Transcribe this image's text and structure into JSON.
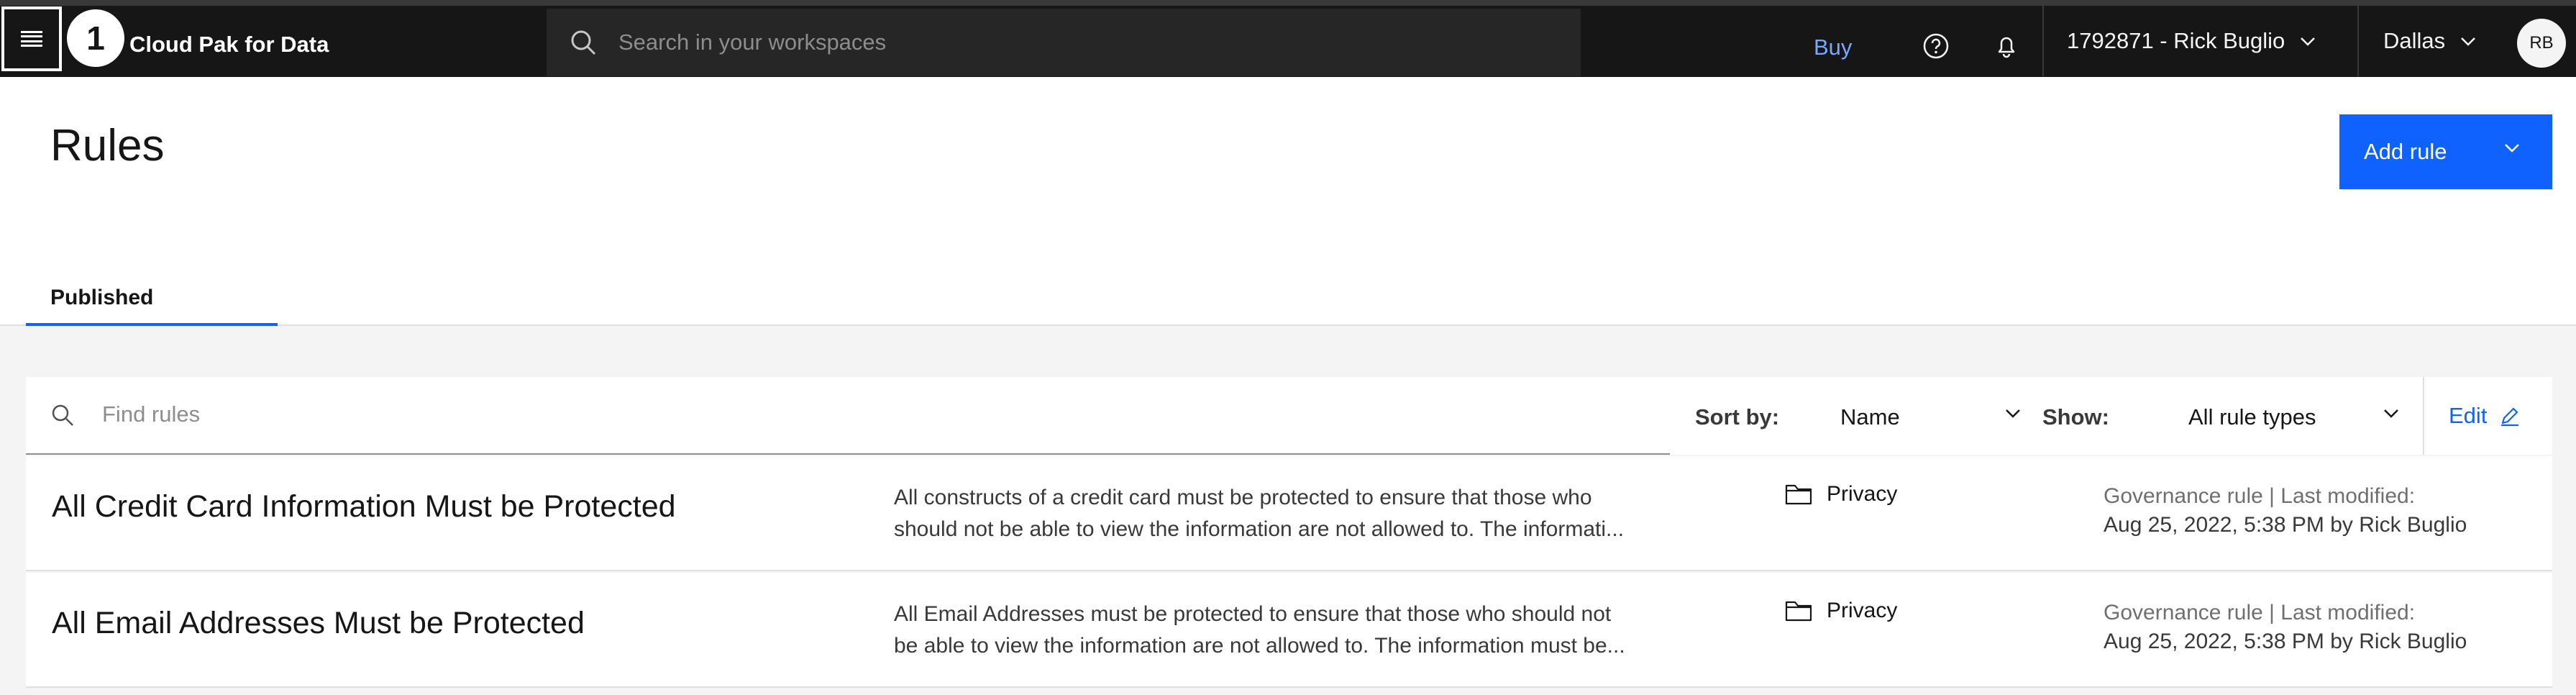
{
  "header": {
    "step_badge": "1",
    "brand": "Cloud Pak for Data",
    "search_placeholder": "Search in your workspaces",
    "buy_label": "Buy",
    "account_label": "1792871 - Rick Buglio",
    "region_label": "Dallas",
    "avatar_initials": "RB"
  },
  "page": {
    "title": "Rules",
    "add_rule_label": "Add rule",
    "tabs": [
      {
        "label": "Published"
      }
    ]
  },
  "toolbar": {
    "find_placeholder": "Find rules",
    "sort_label": "Sort by:",
    "sort_value": "Name",
    "show_label": "Show:",
    "show_value": "All rule types",
    "edit_label": "Edit"
  },
  "rules": [
    {
      "name": "All Credit Card Information Must be Protected",
      "description_line1": "All constructs of a credit card must be protected to ensure that those who",
      "description_line2": "should not be able to view the information are not allowed to. The informati...",
      "category": "Privacy",
      "type": "Governance rule | Last modified:",
      "modified": "Aug 25, 2022, 5:38 PM by Rick Buglio"
    },
    {
      "name": "All Email Addresses Must be Protected",
      "description_line1": "All Email Addresses must be protected to ensure that those who should not",
      "description_line2": "be able to view the information are not allowed to. The information must be...",
      "category": "Privacy",
      "type": "Governance rule | Last modified:",
      "modified": "Aug 25, 2022, 5:38 PM by Rick Buglio"
    }
  ],
  "colors": {
    "header_bg": "#161616",
    "accent": "#0f62fe",
    "link": "#78a9ff",
    "page_bg": "#f4f4f4"
  }
}
